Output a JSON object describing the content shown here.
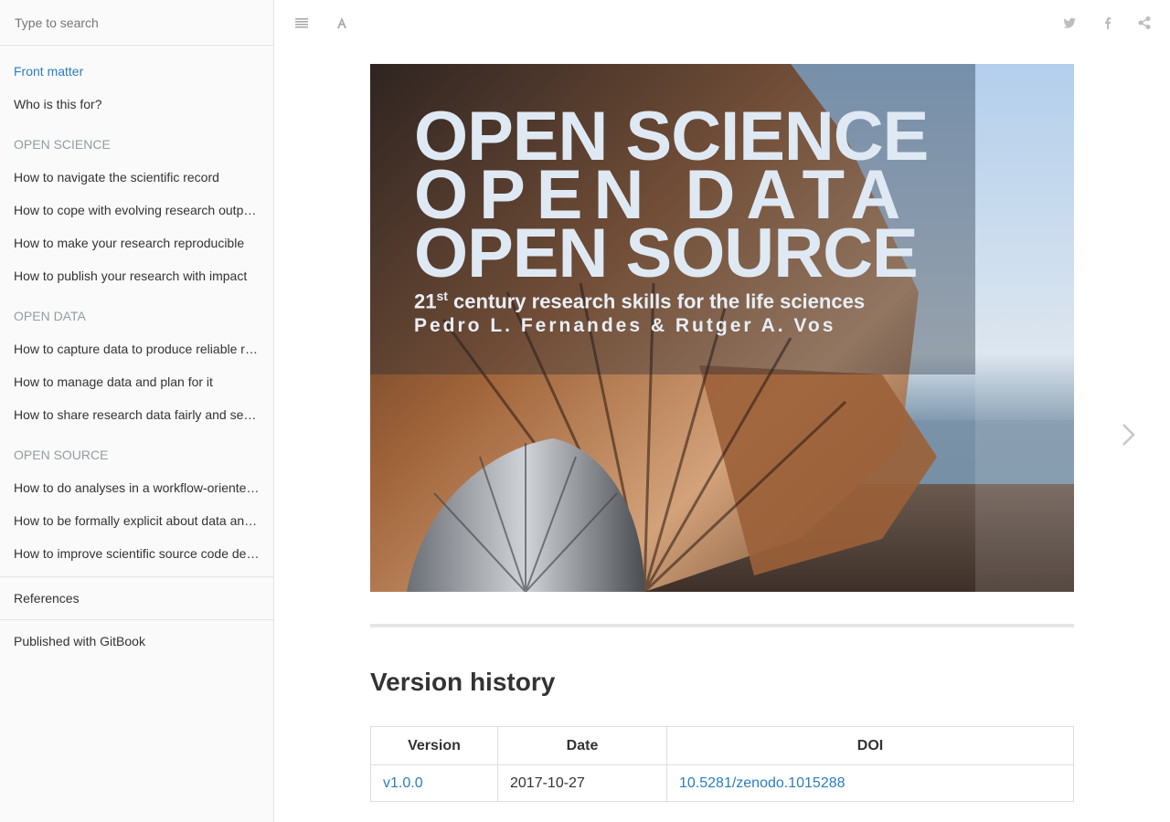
{
  "search": {
    "placeholder": "Type to search"
  },
  "sidebar": {
    "items": [
      {
        "label": "Front matter",
        "type": "link",
        "active": true
      },
      {
        "label": "Who is this for?",
        "type": "link"
      },
      {
        "label": "OPEN SCIENCE",
        "type": "header"
      },
      {
        "label": "How to navigate the scientific record",
        "type": "link"
      },
      {
        "label": "How to cope with evolving research outputs",
        "type": "link"
      },
      {
        "label": "How to make your research reproducible",
        "type": "link"
      },
      {
        "label": "How to publish your research with impact",
        "type": "link"
      },
      {
        "label": "OPEN DATA",
        "type": "header"
      },
      {
        "label": "How to capture data to produce reliable records",
        "type": "link"
      },
      {
        "label": "How to manage data and plan for it",
        "type": "link"
      },
      {
        "label": "How to share research data fairly and sensibly",
        "type": "link"
      },
      {
        "label": "OPEN SOURCE",
        "type": "header"
      },
      {
        "label": "How to do analyses in a workflow-oriented manner",
        "type": "link"
      },
      {
        "label": "How to be formally explicit about data and concepts",
        "type": "link"
      },
      {
        "label": "How to improve scientific source code development",
        "type": "link"
      }
    ],
    "references": "References",
    "published": "Published with GitBook"
  },
  "toolbar": {
    "left_icons": [
      "menu-icon",
      "font-settings-icon"
    ],
    "right_icons": [
      "twitter-icon",
      "facebook-icon",
      "share-icon"
    ]
  },
  "cover": {
    "line1": "OPEN SCIENCE",
    "line2": "OPEN DATA",
    "line3": "OPEN SOURCE",
    "subtitle_num": "21",
    "subtitle_sup": "st",
    "subtitle_rest": " century research skills for the life sciences",
    "authors": "Pedro L. Fernandes & Rutger A. Vos"
  },
  "version_history": {
    "title": "Version history",
    "headers": [
      "Version",
      "Date",
      "DOI"
    ],
    "rows": [
      {
        "version": "v1.0.0",
        "date": "2017-10-27",
        "doi": "10.5281/zenodo.1015288"
      }
    ]
  },
  "colors": {
    "link": "#2a7ec0",
    "header": "#939da3",
    "sidebar_bg": "#fafafa"
  }
}
